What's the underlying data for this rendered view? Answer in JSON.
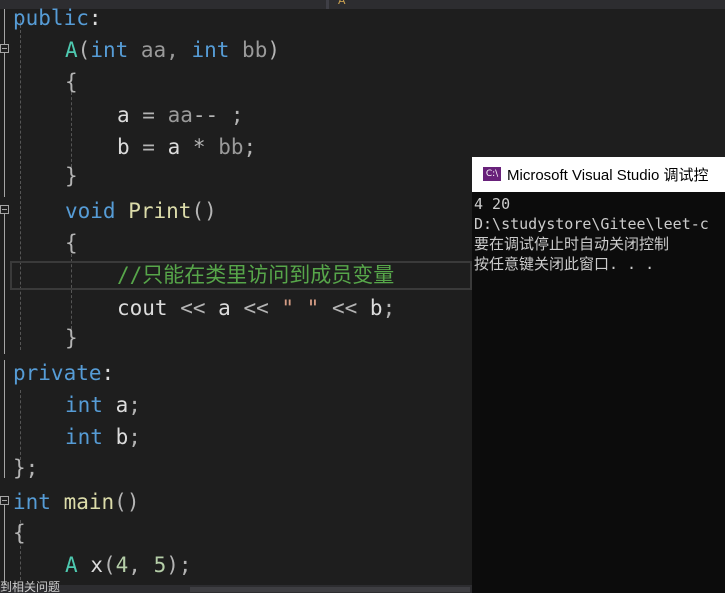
{
  "editor": {
    "tab_label": "A",
    "lines": {
      "l1": {
        "t1": "public",
        "t2": ":"
      },
      "l2": {
        "t1": "A",
        "t2": "(",
        "t3": "int",
        "t4": " aa, ",
        "t5": "int",
        "t6": " bb",
        "t7": ")"
      },
      "l3": {
        "t1": "{"
      },
      "l4": {
        "t1": "a",
        "t2": " = ",
        "t3": "aa",
        "t4": "-- ;"
      },
      "l5": {
        "t1": "b",
        "t2": " = ",
        "t3": "a",
        "t4": " * ",
        "t5": "bb",
        "t6": ";"
      },
      "l6": {
        "t1": "}"
      },
      "l7": {
        "t1": "void",
        "t2": " ",
        "t3": "Print",
        "t4": "()"
      },
      "l8": {
        "t1": "{"
      },
      "l9": {
        "t1": "//只能在类里访问到成员变量"
      },
      "l10": {
        "t1": "cout",
        "t2": " << ",
        "t3": "a",
        "t4": " << ",
        "t5": "\" \"",
        "t6": " << ",
        "t7": "b",
        "t8": ";"
      },
      "l11": {
        "t1": "}"
      },
      "l12": {
        "t1": "private",
        "t2": ":"
      },
      "l13": {
        "t1": "int",
        "t2": " ",
        "t3": "a",
        "t4": ";"
      },
      "l14": {
        "t1": "int",
        "t2": " ",
        "t3": "b",
        "t4": ";"
      },
      "l15": {
        "t1": "};"
      },
      "l16": {
        "t1": "int",
        "t2": " ",
        "t3": "main",
        "t4": "()"
      },
      "l17": {
        "t1": "{"
      },
      "l18": {
        "t1": "A",
        "t2": " ",
        "t3": "x",
        "t4": "(",
        "t5": "4",
        "t6": ", ",
        "t7": "5",
        "t8": ");"
      }
    }
  },
  "console": {
    "title": "Microsoft Visual Studio 调试控",
    "icon_label": "C:\\",
    "output": [
      "4 20",
      "D:\\studystore\\Gitee\\leet-c",
      "要在调试停止时自动关闭控制",
      "按任意键关闭此窗口. . ."
    ]
  },
  "status": {
    "text": "到相关问题"
  },
  "colors": {
    "keyword": "#569cd6",
    "function": "#dcdcaa",
    "class": "#4ec9b0",
    "number": "#b5cea8",
    "comment": "#57a64a",
    "background": "#1e1e1e"
  }
}
